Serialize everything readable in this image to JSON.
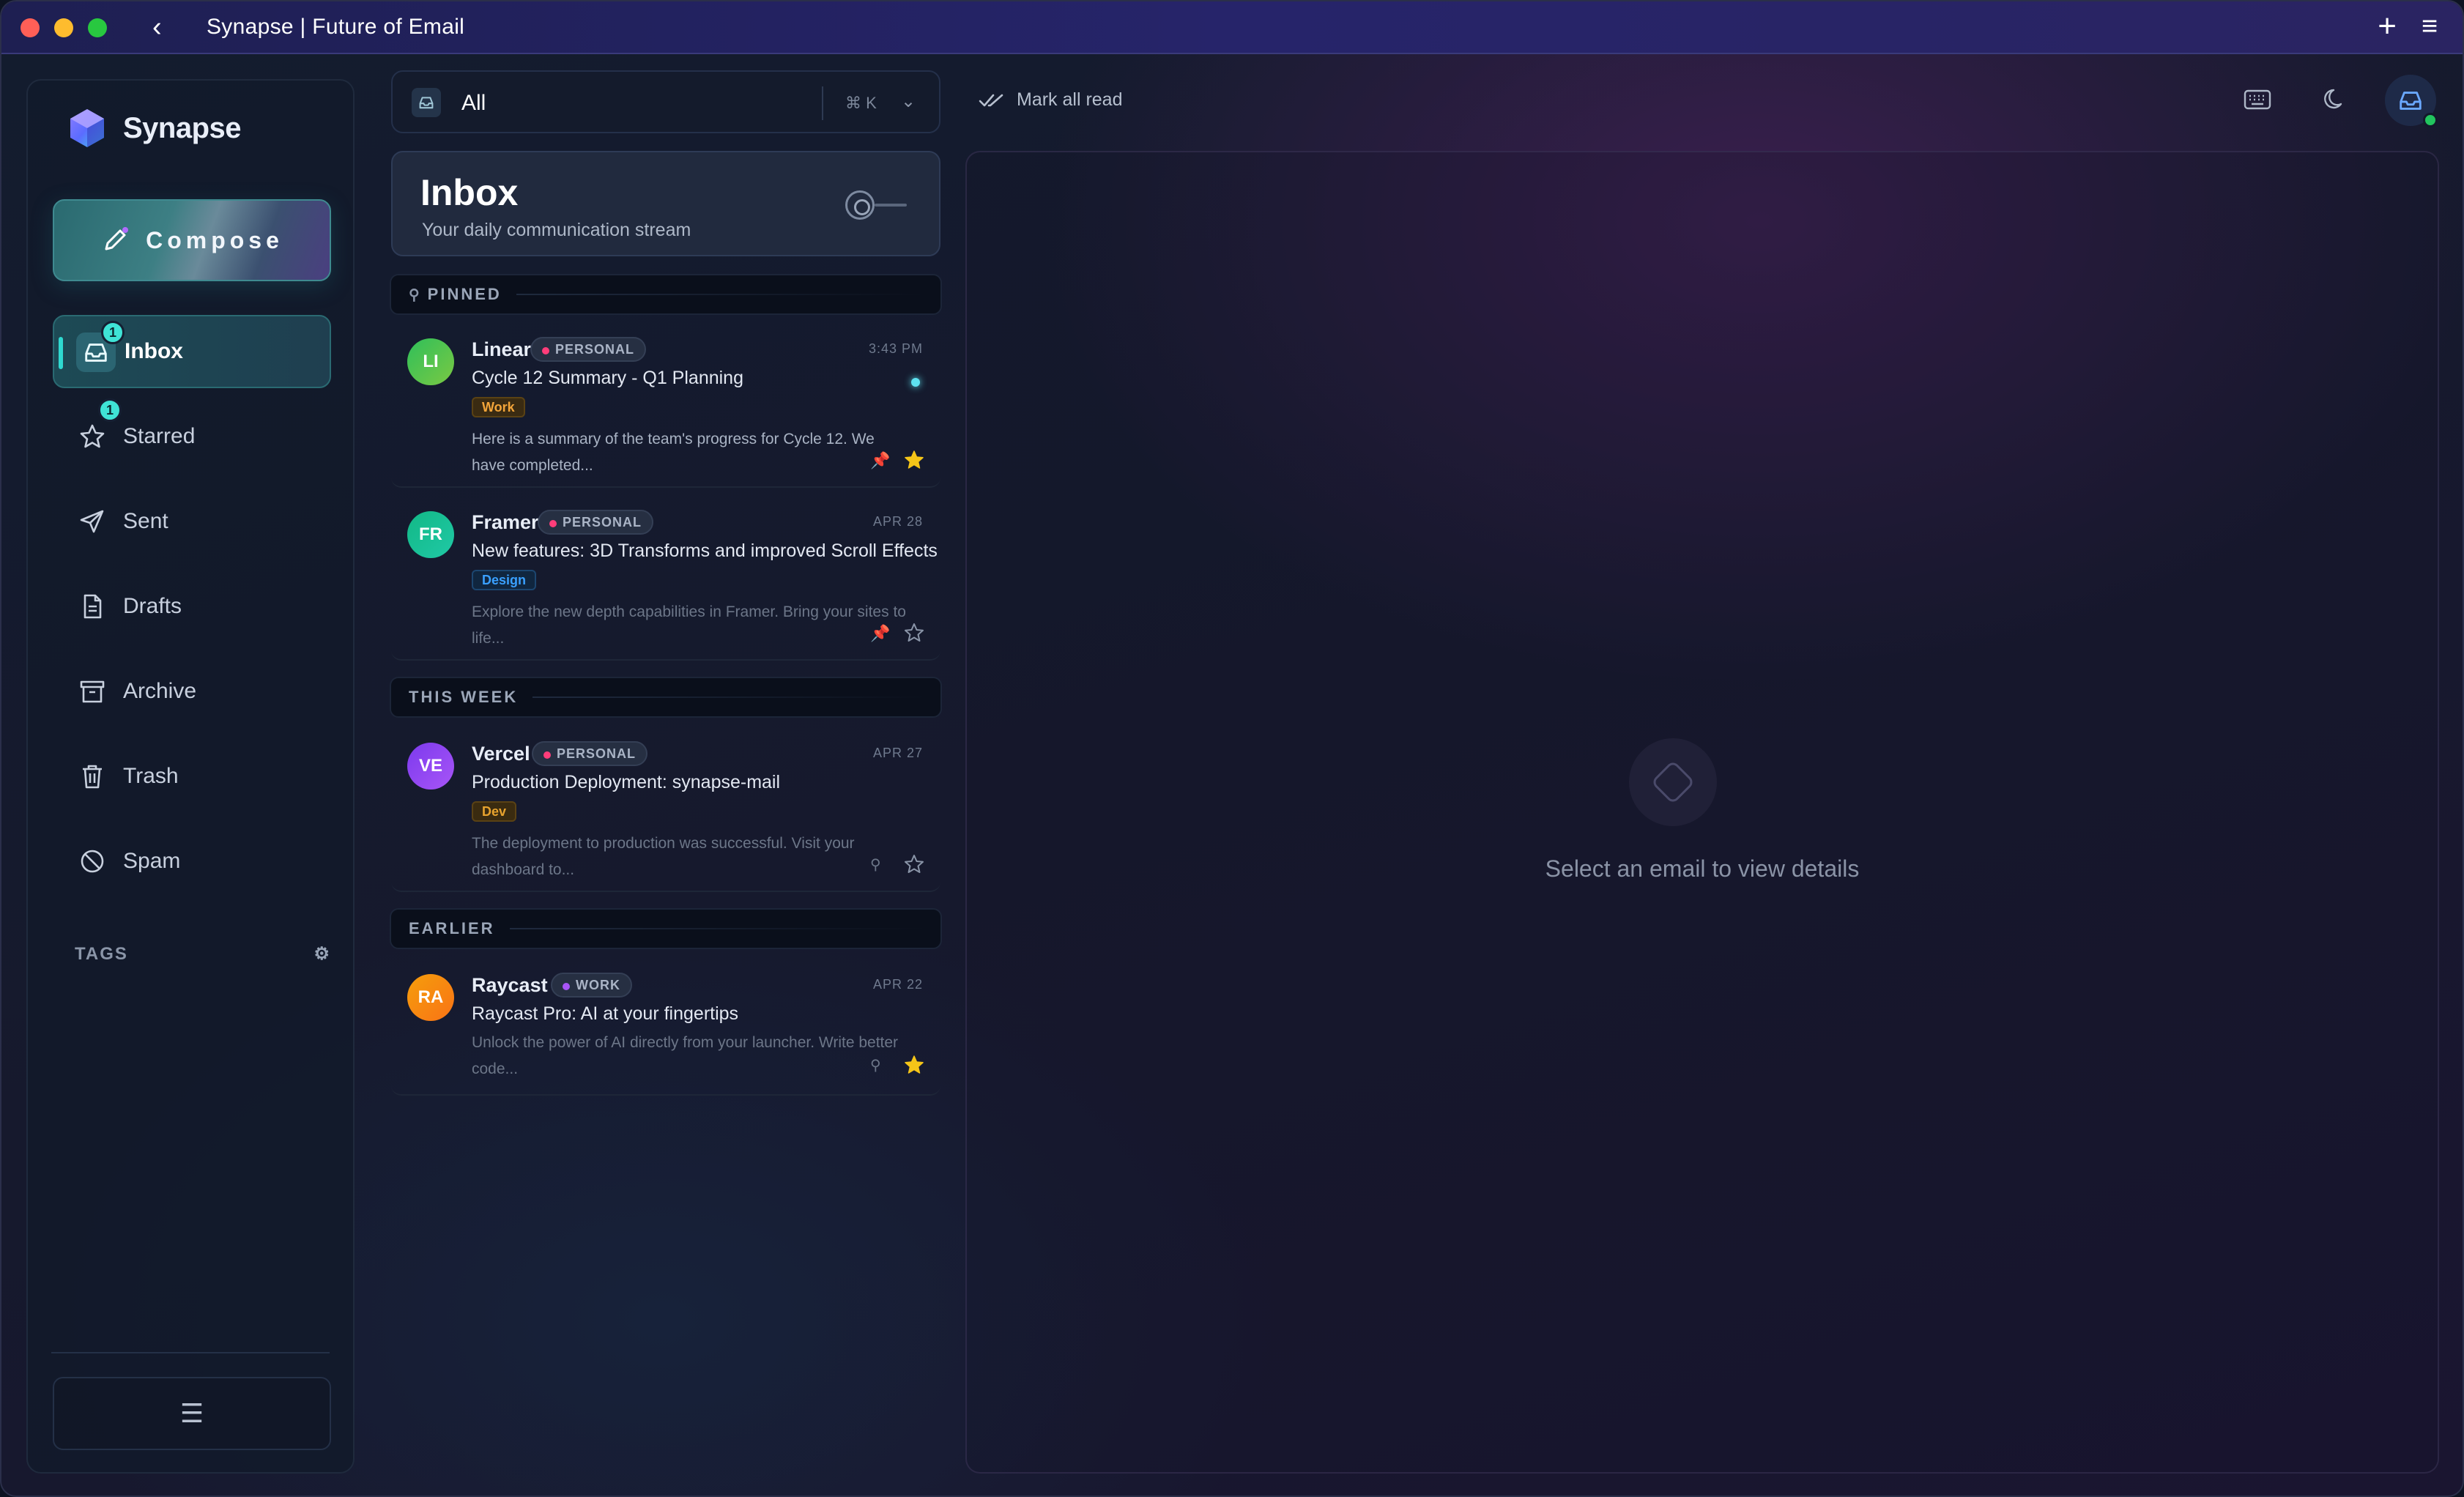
{
  "window": {
    "title": "Synapse | Future of Email"
  },
  "brand": {
    "name": "Synapse",
    "accent": "#2fd9d0"
  },
  "compose": {
    "label": "Compose"
  },
  "nav": {
    "items": [
      {
        "label": "Inbox",
        "icon": "inbox-icon",
        "badge": "1",
        "active": true
      },
      {
        "label": "Starred",
        "icon": "star-icon",
        "badge": "1"
      },
      {
        "label": "Sent",
        "icon": "send-icon"
      },
      {
        "label": "Drafts",
        "icon": "document-icon"
      },
      {
        "label": "Archive",
        "icon": "archive-icon"
      },
      {
        "label": "Trash",
        "icon": "trash-icon"
      },
      {
        "label": "Spam",
        "icon": "ban-icon"
      }
    ]
  },
  "tags": {
    "label": "TAGS"
  },
  "filter": {
    "label": "All",
    "shortcut": "⌘ K"
  },
  "inbox": {
    "title": "Inbox",
    "subtitle": "Your daily communication stream"
  },
  "sections": {
    "pinned": "PINNED",
    "this_week": "THIS WEEK",
    "earlier": "EARLIER"
  },
  "emails": [
    {
      "initials": "LI",
      "sender": "Linear",
      "category": "PERSONAL",
      "date": "3:43 PM",
      "subject": "Cycle 12 Summary - Q1 Planning",
      "label": "Work",
      "preview": "Here is a summary of the team's progress for Cycle 12. We have completed...",
      "unread": true,
      "pinned": true,
      "starred": true
    },
    {
      "initials": "FR",
      "sender": "Framer",
      "category": "PERSONAL",
      "date": "APR 28",
      "subject": "New features: 3D Transforms and improved Scroll Effects",
      "label": "Design",
      "preview": "Explore the new depth capabilities in Framer. Bring your sites to life...",
      "pinned": true,
      "starred": false
    },
    {
      "initials": "VE",
      "sender": "Vercel",
      "category": "PERSONAL",
      "date": "APR 27",
      "subject": "Production Deployment: synapse-mail",
      "label": "Dev",
      "preview": "The deployment to production was successful. Visit your dashboard to...",
      "pinned": false,
      "starred": false
    },
    {
      "initials": "RA",
      "sender": "Raycast",
      "category": "WORK",
      "date": "APR 22",
      "subject": "Raycast Pro: AI at your fingertips",
      "label": "",
      "preview": "Unlock the power of AI directly from your launcher. Write better code...",
      "pinned": false,
      "starred": true
    }
  ],
  "toolbar": {
    "mark_all_read": "Mark all read"
  },
  "detail": {
    "empty_text": "Select an email to view details"
  }
}
